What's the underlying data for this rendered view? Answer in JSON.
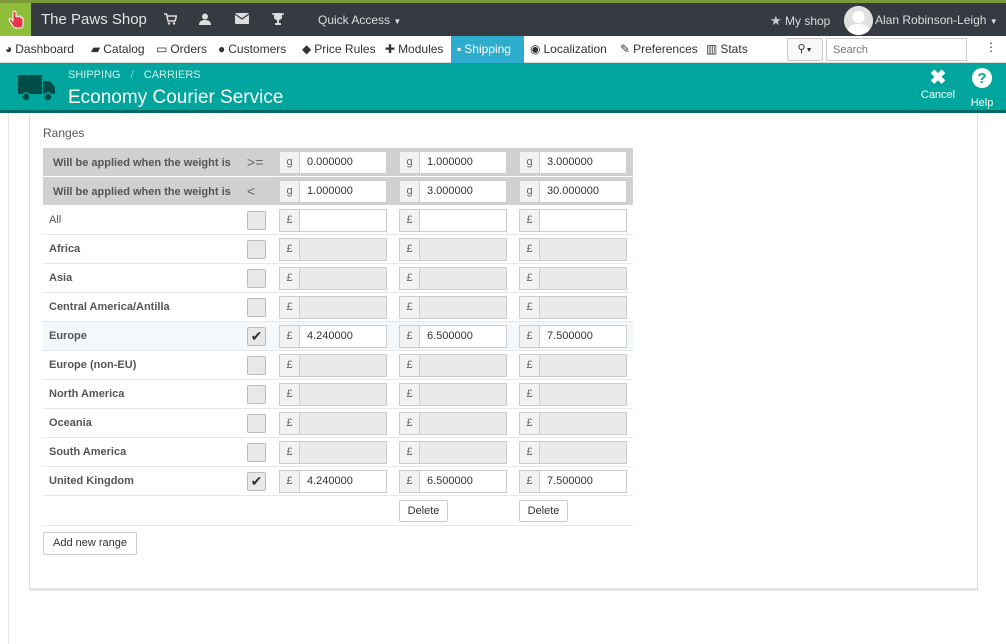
{
  "topbar": {
    "shop_name": "The Paws Shop",
    "quick_access": "Quick Access",
    "my_shop": "My shop",
    "user_name": "Alan Robinson-Leigh"
  },
  "nav": {
    "items": [
      "Dashboard",
      "Catalog",
      "Orders",
      "Customers",
      "Price Rules",
      "Modules",
      "Shipping",
      "Localization",
      "Preferences",
      "Stats"
    ],
    "active": "Shipping",
    "search_placeholder": "Search"
  },
  "header": {
    "breadcrumb_1": "SHIPPING",
    "breadcrumb_sep": "/",
    "breadcrumb_2": "CARRIERS",
    "title": "Economy Courier Service",
    "cancel": "Cancel",
    "help": "Help"
  },
  "ranges": {
    "label": "Ranges",
    "heading_applied": "Will be applied when the weight is",
    "op_ge": ">=",
    "op_lt": "<",
    "weight_unit": "g",
    "currency": "£",
    "from": [
      "0.000000",
      "1.000000",
      "3.000000"
    ],
    "to": [
      "1.000000",
      "3.000000",
      "30.000000"
    ],
    "zones": [
      {
        "name": "All",
        "checked": false,
        "prices": [
          "",
          "",
          ""
        ],
        "enabled": true
      },
      {
        "name": "Africa",
        "checked": false,
        "prices": [
          "",
          "",
          ""
        ],
        "enabled": false
      },
      {
        "name": "Asia",
        "checked": false,
        "prices": [
          "",
          "",
          ""
        ],
        "enabled": false
      },
      {
        "name": "Central America/Antilla",
        "checked": false,
        "prices": [
          "",
          "",
          ""
        ],
        "enabled": false
      },
      {
        "name": "Europe",
        "checked": true,
        "prices": [
          "4.240000",
          "6.500000",
          "7.500000"
        ],
        "enabled": true
      },
      {
        "name": "Europe (non-EU)",
        "checked": false,
        "prices": [
          "",
          "",
          ""
        ],
        "enabled": false
      },
      {
        "name": "North America",
        "checked": false,
        "prices": [
          "",
          "",
          ""
        ],
        "enabled": false
      },
      {
        "name": "Oceania",
        "checked": false,
        "prices": [
          "",
          "",
          ""
        ],
        "enabled": false
      },
      {
        "name": "South America",
        "checked": false,
        "prices": [
          "",
          "",
          ""
        ],
        "enabled": false
      },
      {
        "name": "United Kingdom",
        "checked": true,
        "prices": [
          "4.240000",
          "6.500000",
          "7.500000"
        ],
        "enabled": true
      }
    ],
    "delete_label": "Delete",
    "add_range": "Add new range"
  }
}
